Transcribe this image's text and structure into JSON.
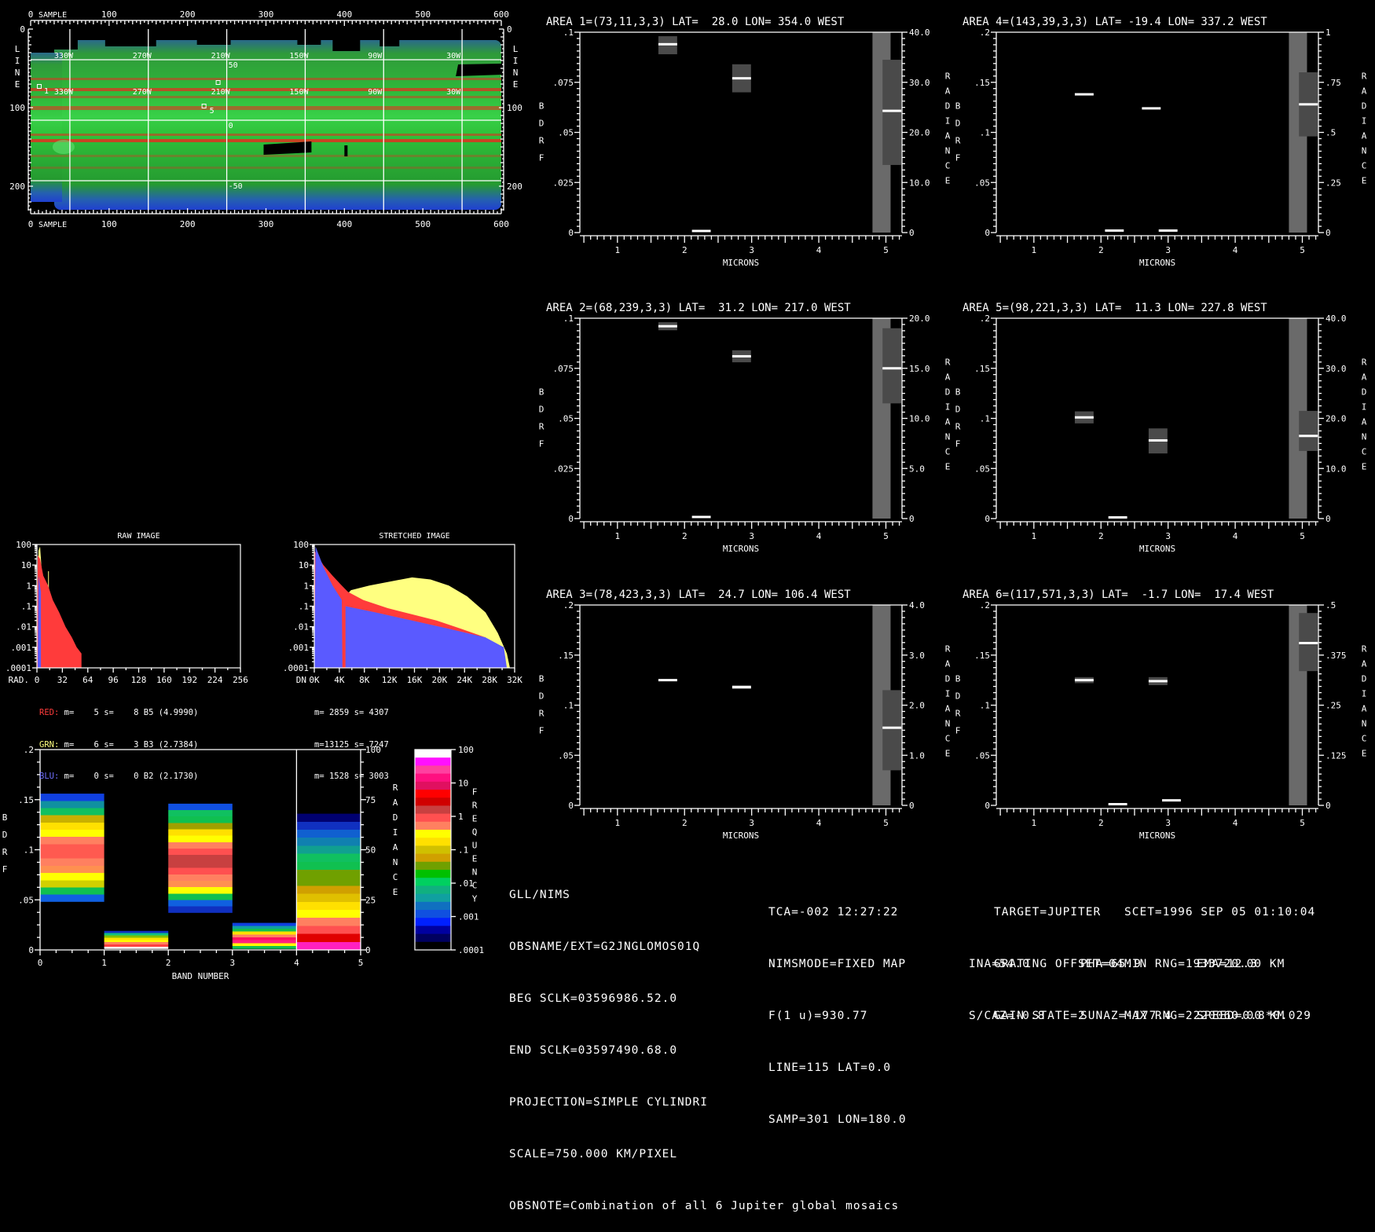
{
  "colors": {
    "red": "#ff3b3b",
    "yellow": "#ffff80",
    "blue": "#5a5aff",
    "gray_light": "#6a6a6a",
    "gray_dark": "#4a4a4a"
  },
  "map": {
    "top_axis_label": "SAMPLE",
    "bottom_axis_label": "SAMPLE",
    "side_axis_label": "LINE",
    "sample_ticks": [
      "0",
      "100",
      "200",
      "300",
      "400",
      "500",
      "600"
    ],
    "line_ticks": [
      "0",
      "100",
      "200"
    ],
    "lon_labels": [
      "330W",
      "270W",
      "210W",
      "150W",
      "90W",
      "30W"
    ],
    "lat_labels": [
      "50",
      "0",
      "-50"
    ],
    "area_markers": [
      {
        "id": "1",
        "sample": 11,
        "line": 73
      },
      {
        "id": "2",
        "sample": 239,
        "line": 68
      },
      {
        "id": "5",
        "sample": 221,
        "line": 98
      }
    ],
    "marker_labels": [
      "1",
      "5"
    ]
  },
  "area_plots": [
    {
      "title": "AREA 1=(73,11,3,3) LAT=  28.0 LON= 354.0 WEST",
      "left_ticks": [
        "0",
        ".025",
        ".05",
        ".075",
        ".1"
      ],
      "left_max": 0.1,
      "right_ticks": [
        "0",
        "10.0",
        "20.0",
        "30.0",
        "40.0"
      ],
      "right_max": 40,
      "bdrf": [
        {
          "micron": 1.75,
          "value": 0.094,
          "lo": 0.089,
          "hi": 0.098
        },
        {
          "micron": 2.25,
          "value": 0.0008
        },
        {
          "micron": 2.85,
          "value": 0.077,
          "lo": 0.07,
          "hi": 0.084
        }
      ],
      "radiance": {
        "column_top": 40,
        "value": 24.3,
        "lo": 13.5,
        "hi": 34.5
      }
    },
    {
      "title": "AREA 4=(143,39,3,3) LAT= -19.4 LON= 337.2 WEST",
      "left_ticks": [
        "0",
        ".05",
        ".1",
        ".15",
        ".2"
      ],
      "left_max": 0.2,
      "right_ticks": [
        "0",
        ".25",
        ".5",
        ".75",
        "1"
      ],
      "right_max": 1,
      "bdrf": [
        {
          "micron": 1.75,
          "value": 0.138
        },
        {
          "micron": 2.2,
          "value": 0.002
        },
        {
          "micron": 2.75,
          "value": 0.124
        },
        {
          "micron": 3.0,
          "value": 0.002
        }
      ],
      "radiance": {
        "column_top": 1,
        "value": 0.64,
        "lo": 0.48,
        "hi": 0.8
      }
    },
    {
      "title": "AREA 2=(68,239,3,3) LAT=  31.2 LON= 217.0 WEST",
      "left_ticks": [
        "0",
        ".025",
        ".05",
        ".075",
        ".1"
      ],
      "left_max": 0.1,
      "right_ticks": [
        "0",
        "5.0",
        "10.0",
        "15.0",
        "20.0"
      ],
      "right_max": 20,
      "bdrf": [
        {
          "micron": 1.75,
          "value": 0.096,
          "lo": 0.094,
          "hi": 0.098
        },
        {
          "micron": 2.25,
          "value": 0.0008
        },
        {
          "micron": 2.85,
          "value": 0.081,
          "lo": 0.078,
          "hi": 0.084
        }
      ],
      "radiance": {
        "column_top": 20,
        "value": 15,
        "lo": 11.5,
        "hi": 19
      }
    },
    {
      "title": "AREA 5=(98,221,3,3) LAT=  11.3 LON= 227.8 WEST",
      "left_ticks": [
        "0",
        ".05",
        ".1",
        ".15",
        ".2"
      ],
      "left_max": 0.2,
      "right_ticks": [
        "0",
        "10.0",
        "20.0",
        "30.0",
        "40.0"
      ],
      "right_max": 40,
      "bdrf": [
        {
          "micron": 1.75,
          "value": 0.101,
          "lo": 0.095,
          "hi": 0.107
        },
        {
          "micron": 2.25,
          "value": 0.001
        },
        {
          "micron": 2.85,
          "value": 0.078,
          "lo": 0.065,
          "hi": 0.09
        }
      ],
      "radiance": {
        "column_top": 40,
        "value": 16.5,
        "lo": 13.5,
        "hi": 21.5
      }
    },
    {
      "title": "AREA 3=(78,423,3,3) LAT=  24.7 LON= 106.4 WEST",
      "left_ticks": [
        "0",
        ".05",
        ".1",
        ".15",
        ".2"
      ],
      "left_max": 0.2,
      "right_ticks": [
        "0",
        "1.0",
        "2.0",
        "3.0",
        "4.0"
      ],
      "right_max": 4,
      "bdrf": [
        {
          "micron": 1.75,
          "value": 0.125
        },
        {
          "micron": 2.85,
          "value": 0.118,
          "lo": 0.116,
          "hi": 0.12
        }
      ],
      "radiance": {
        "column_top": 4,
        "value": 1.55,
        "lo": 0.7,
        "hi": 2.3
      }
    },
    {
      "title": "AREA 6=(117,571,3,3) LAT=  -1.7 LON=  17.4 WEST",
      "left_ticks": [
        "0",
        ".05",
        ".1",
        ".15",
        ".2"
      ],
      "left_max": 0.2,
      "right_ticks": [
        "0",
        ".125",
        ".25",
        ".375",
        ".5"
      ],
      "right_max": 0.5,
      "bdrf": [
        {
          "micron": 1.75,
          "value": 0.125,
          "lo": 0.122,
          "hi": 0.128
        },
        {
          "micron": 2.25,
          "value": 0.001
        },
        {
          "micron": 2.85,
          "value": 0.124,
          "lo": 0.12,
          "hi": 0.128
        },
        {
          "micron": 3.05,
          "value": 0.005
        }
      ],
      "radiance": {
        "column_top": 0.5,
        "value": 0.405,
        "lo": 0.335,
        "hi": 0.48
      }
    }
  ],
  "area_axis": {
    "x_label": "MICRONS",
    "x_ticks": [
      "1",
      "2",
      "3",
      "4",
      "5"
    ],
    "x_range": [
      0.44,
      5.24
    ],
    "left_label": "BDRF",
    "right_label": "RADIANCE"
  },
  "chart_data": [
    {
      "type": "area",
      "title": "RAW IMAGE",
      "xlabel": "RAD.",
      "x_ticks": [
        "0",
        "32",
        "64",
        "96",
        "128",
        "160",
        "192",
        "224",
        "256"
      ],
      "xlim": [
        0,
        256
      ],
      "ylim": [
        0.0001,
        100
      ],
      "yscale": "log",
      "y_ticks": [
        "100",
        "10",
        "1",
        ".1",
        ".01",
        ".001",
        ".0001"
      ],
      "series": [
        {
          "name": "GRN",
          "color": "yellow",
          "points": [
            [
              0,
              0.0001
            ],
            [
              2,
              50
            ],
            [
              4,
              80
            ],
            [
              5,
              20
            ],
            [
              6,
              5
            ],
            [
              8,
              2
            ],
            [
              9,
              0.0001
            ],
            [
              14,
              0.0001
            ],
            [
              14,
              5
            ],
            [
              15,
              5
            ],
            [
              15,
              0.0001
            ]
          ]
        },
        {
          "name": "RED",
          "color": "red",
          "points": [
            [
              0,
              0.0001
            ],
            [
              1,
              30
            ],
            [
              4,
              20
            ],
            [
              8,
              3
            ],
            [
              14,
              1
            ],
            [
              20,
              0.2
            ],
            [
              28,
              0.05
            ],
            [
              36,
              0.01
            ],
            [
              44,
              0.003
            ],
            [
              50,
              0.001
            ],
            [
              56,
              0.0005
            ],
            [
              56,
              0.0001
            ]
          ]
        },
        {
          "name": "BLU",
          "color": "blue",
          "points": [
            [
              1,
              0.0001
            ],
            [
              2,
              3
            ],
            [
              5,
              0.5
            ],
            [
              5,
              0.0001
            ]
          ]
        }
      ]
    },
    {
      "type": "area",
      "title": "STRETCHED IMAGE",
      "xlabel": "DN",
      "x_ticks": [
        "0K",
        "4K",
        "8K",
        "12K",
        "16K",
        "20K",
        "24K",
        "28K",
        "32K"
      ],
      "xlim": [
        0,
        32768
      ],
      "ylim": [
        0.0001,
        100
      ],
      "yscale": "log",
      "y_ticks": [
        "100",
        "10",
        "1",
        ".1",
        ".01",
        ".001",
        ".0001"
      ],
      "series": [
        {
          "name": "GRN",
          "color": "yellow",
          "points": [
            [
              0,
              0.0001
            ],
            [
              500,
              0.0005
            ],
            [
              1500,
              0.003
            ],
            [
              3000,
              0.02
            ],
            [
              4500,
              0.2
            ],
            [
              6000,
              0.6
            ],
            [
              9000,
              1
            ],
            [
              12000,
              1.5
            ],
            [
              16000,
              2.5
            ],
            [
              19000,
              2
            ],
            [
              22000,
              1
            ],
            [
              25000,
              0.3
            ],
            [
              28000,
              0.05
            ],
            [
              30000,
              0.005
            ],
            [
              31500,
              0.0005
            ],
            [
              32000,
              0.0001
            ]
          ]
        },
        {
          "name": "RED",
          "color": "red",
          "points": [
            [
              0,
              0.0001
            ],
            [
              0,
              50
            ],
            [
              1500,
              10
            ],
            [
              3000,
              3
            ],
            [
              4500,
              1
            ],
            [
              5500,
              0.5
            ],
            [
              8000,
              0.2
            ],
            [
              12000,
              0.08
            ],
            [
              16000,
              0.04
            ],
            [
              20000,
              0.02
            ],
            [
              24000,
              0.008
            ],
            [
              28000,
              0.003
            ],
            [
              30000,
              0.001
            ],
            [
              31000,
              0.0003
            ],
            [
              31500,
              0.0001
            ]
          ]
        },
        {
          "name": "BLU",
          "color": "blue",
          "points": [
            [
              0,
              0.0001
            ],
            [
              200,
              80
            ],
            [
              1500,
              8
            ],
            [
              3000,
              1
            ],
            [
              4500,
              0.2
            ],
            [
              4600,
              0.0001
            ],
            [
              5100,
              0.0001
            ],
            [
              5100,
              0.1
            ],
            [
              10000,
              0.05
            ],
            [
              16000,
              0.02
            ],
            [
              22000,
              0.008
            ],
            [
              28000,
              0.003
            ],
            [
              31000,
              0.001
            ],
            [
              31500,
              0.0001
            ]
          ]
        }
      ]
    }
  ],
  "histogram_stats": {
    "raw": [
      {
        "channel": "RED:",
        "text": " m=    5 s=    8 B5 (4.9990)"
      },
      {
        "channel": "GRN:",
        "text": " m=    6 s=    3 B3 (2.7384)"
      },
      {
        "channel": "BLU:",
        "text": " m=    0 s=    0 B2 (2.1730)"
      }
    ],
    "stretched": [
      "m= 2859 s= 4307",
      "m=13125 s= 7247",
      "m= 1528 s= 3003"
    ]
  },
  "band_plot": {
    "x_label": "BAND NUMBER",
    "x_ticks": [
      "0",
      "1",
      "2",
      "3",
      "4",
      "5"
    ],
    "left_label": "BDRF",
    "left_ticks": [
      "0",
      ".05",
      ".1",
      ".15",
      ".2"
    ],
    "right_label": "RADIANCE",
    "right_ticks": [
      "0",
      "25",
      "50",
      "75",
      "100"
    ],
    "freq_label": "FREQUENCY",
    "freq_ticks": [
      "100",
      "10",
      "1",
      ".1",
      ".01",
      ".001",
      ".0001"
    ],
    "columns": [
      {
        "band": 0,
        "scale": "bdrf",
        "top": 0.156,
        "bottom": 0.048,
        "stops": [
          "#1040e0",
          "#1090a0",
          "#10c060",
          "#c8b000",
          "#ffe000",
          "#ffff00",
          "#ff8060",
          "#ff5a50",
          "#ff5a50",
          "#ff8060",
          "#ff9050",
          "#ffff00",
          "#d0d000",
          "#10c050",
          "#1060e0"
        ]
      },
      {
        "band": 1,
        "scale": "bdrf",
        "top": 0.019,
        "bottom": 0.001,
        "stops": [
          "#1030c0",
          "#10c080",
          "#80c000",
          "#ffe000",
          "#ffff00",
          "#ff8060",
          "#ff4040",
          "#ffffff"
        ]
      },
      {
        "band": 2,
        "scale": "bdrf",
        "top": 0.146,
        "bottom": 0.037,
        "stops": [
          "#1050e0",
          "#10c060",
          "#10c050",
          "#a0a000",
          "#ffe000",
          "#ffff00",
          "#ff8060",
          "#ff5050",
          "#c84040",
          "#c84040",
          "#ff5050",
          "#ff8060",
          "#ff9050",
          "#ffff00",
          "#10c050",
          "#1060e0",
          "#1030c0"
        ]
      },
      {
        "band": 3,
        "scale": "bdrf",
        "top": 0.027,
        "bottom": 0.001,
        "stops": [
          "#1040e0",
          "#10a0a0",
          "#10c050",
          "#ffe000",
          "#ff8060",
          "#ff1060",
          "#ff2080",
          "#ffff00",
          "#10c050"
        ]
      },
      {
        "band": 4,
        "scale": "radiance",
        "top": 68,
        "bottom": 0,
        "stops": [
          "#000070",
          "#1030c0",
          "#1060d0",
          "#1080b0",
          "#10a090",
          "#10c060",
          "#10c050",
          "#70a000",
          "#70a000",
          "#d0a000",
          "#e0c000",
          "#ffe000",
          "#ffff00",
          "#ff8060",
          "#ff5050",
          "#e00000",
          "#ff20c0"
        ]
      }
    ],
    "colorbar": [
      "#ffffff",
      "#ff10ff",
      "#ff40a0",
      "#ff1080",
      "#e01060",
      "#ff0000",
      "#d00000",
      "#c84040",
      "#ff5050",
      "#ff8060",
      "#ffff00",
      "#ffe000",
      "#d0c000",
      "#d0a000",
      "#70a000",
      "#00c000",
      "#00d060",
      "#10b080",
      "#10a0a0",
      "#1070c0",
      "#1050e0",
      "#0020ff",
      "#0000a0",
      "#000060",
      "#000000"
    ]
  },
  "info": {
    "instrument": "GLL/NIMS",
    "obsname": "OBSNAME/EXT=G2JNGLOMOS01Q",
    "beg_sclk": "BEG SCLK=03596986.52.0",
    "end_sclk": "END SCLK=03597490.68.0",
    "projection": "PROJECTION=SIMPLE CYLINDRI",
    "scale": "SCALE=750.000 KM/PIXEL",
    "obsnote": "OBSNOTE=Combination of all 6 Jupiter global mosaics",
    "tca": "TCA=-002 12:27:22",
    "nimsmode": "NIMSMODE=FIXED MAP",
    "f1u": "F(1 u)=930.77",
    "line": "LINE=115",
    "lat": "LAT=0.0",
    "samp": "SAMP=301",
    "lon": "LON=180.0",
    "target": "TARGET=JUPITER",
    "scet": "SCET=1996 SEP 05 01:10:04",
    "grating": "GRATING OFFSET=04",
    "min_rng": "MIN RNG=1933720.00 KM",
    "gain": "GAIN STATE=2",
    "max_rng": "MAX RNG=2220060.00 KM",
    "ina": "INA=54.0",
    "pha": "PHA=65.9",
    "ema": "EMA=12.3",
    "scaz": "S/CAZ=-0.8",
    "sunaz": "SUNAZ=-177.4",
    "speed": "SPEED=0.8*0.029"
  }
}
